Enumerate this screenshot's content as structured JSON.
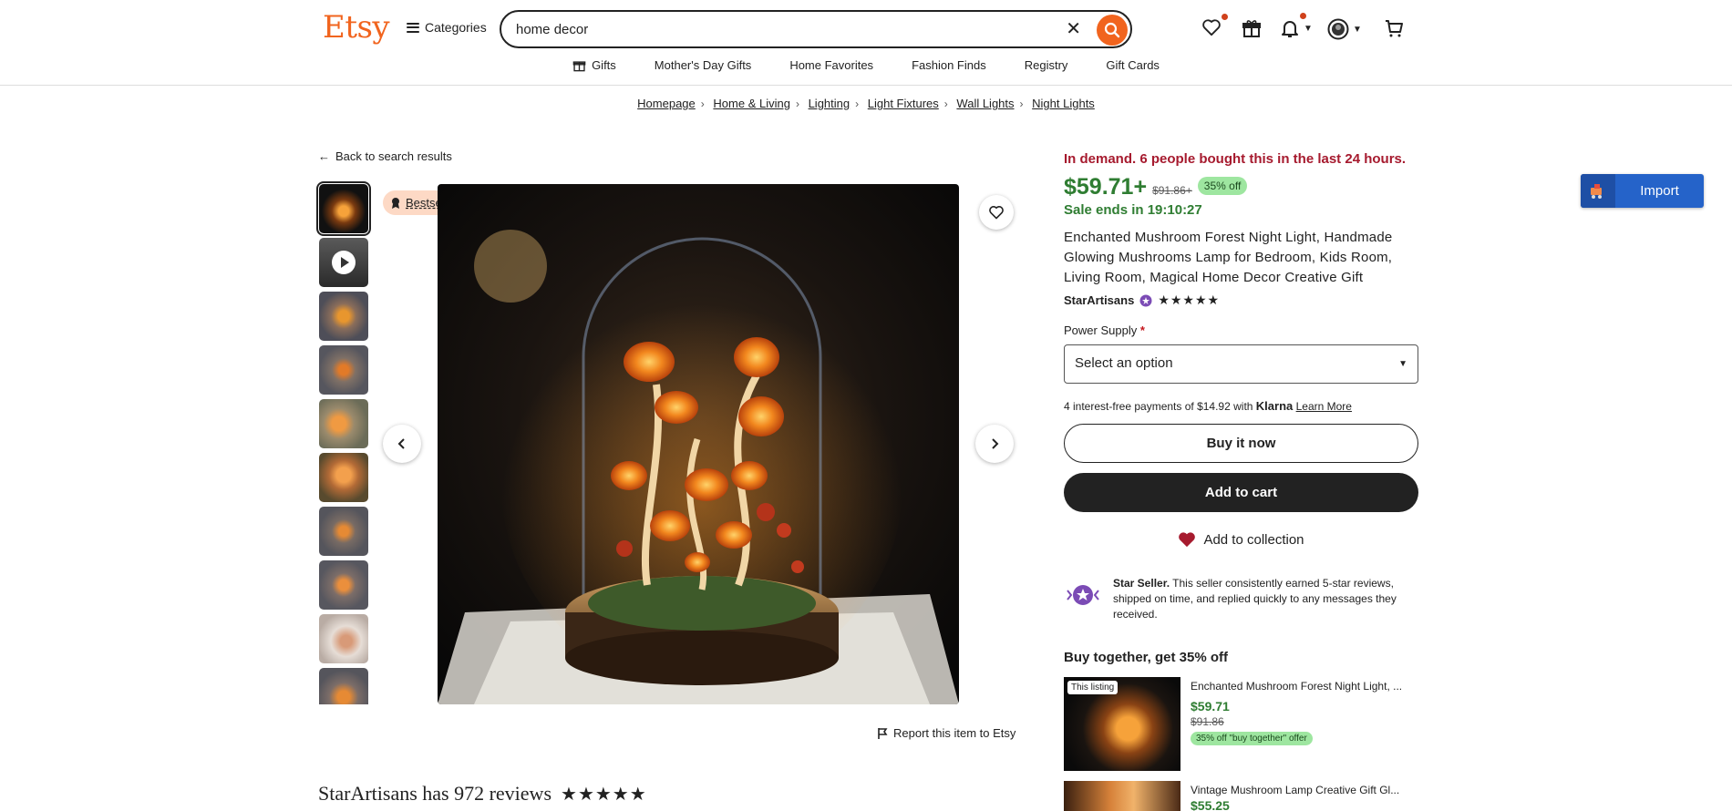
{
  "header": {
    "logo": "Etsy",
    "categories_label": "Categories",
    "search_value": "home decor"
  },
  "nav": [
    "Gifts",
    "Mother's Day Gifts",
    "Home Favorites",
    "Fashion Finds",
    "Registry",
    "Gift Cards"
  ],
  "breadcrumbs": [
    "Homepage",
    "Home & Living",
    "Lighting",
    "Light Fixtures",
    "Wall Lights",
    "Night Lights"
  ],
  "back_label": "Back to search results",
  "badge": "Bestseller",
  "report_label": "Report this item to Etsy",
  "reviews_heading": "StarArtisans has 972 reviews",
  "review_stars": "★★★★★",
  "listing": {
    "demand": "In demand. 6 people bought this in the last 24 hours.",
    "price": "$59.71+",
    "original_price": "$91.86+",
    "discount": "35% off",
    "sale_ends": "Sale ends in 19:10:27",
    "title": "Enchanted Mushroom Forest Night Light, Handmade Glowing Mushrooms Lamp for Bedroom, Kids Room, Living Room, Magical Home Decor Creative Gift",
    "shop_name": "StarArtisans",
    "shop_stars": "★★★★★",
    "option_label": "Power Supply",
    "option_required": "*",
    "select_placeholder": "Select an option",
    "klarna_text": "4 interest-free payments of $14.92 with",
    "klarna_brand": "Klarna",
    "klarna_link": "Learn More",
    "buy_now": "Buy it now",
    "add_to_cart": "Add to cart",
    "add_to_collection": "Add to collection",
    "star_seller_bold": "Star Seller.",
    "star_seller_text": "This seller consistently earned 5-star reviews, shipped on time, and replied quickly to any messages they received."
  },
  "buy_together": {
    "heading": "Buy together, get 35% off",
    "items": [
      {
        "tag": "This listing",
        "name": "Enchanted Mushroom Forest Night Light, ...",
        "price": "$59.71",
        "original": "$91.86",
        "offer": "35% off \"buy together\" offer"
      },
      {
        "name": "Vintage Mushroom Lamp Creative Gift Gl...",
        "price": "$55.25"
      }
    ]
  },
  "import_button": "Import",
  "colors": {
    "brand": "#f1641e",
    "price_green": "#2f7d32",
    "demand_red": "#a61a2e",
    "import_blue": "#2563c9"
  }
}
